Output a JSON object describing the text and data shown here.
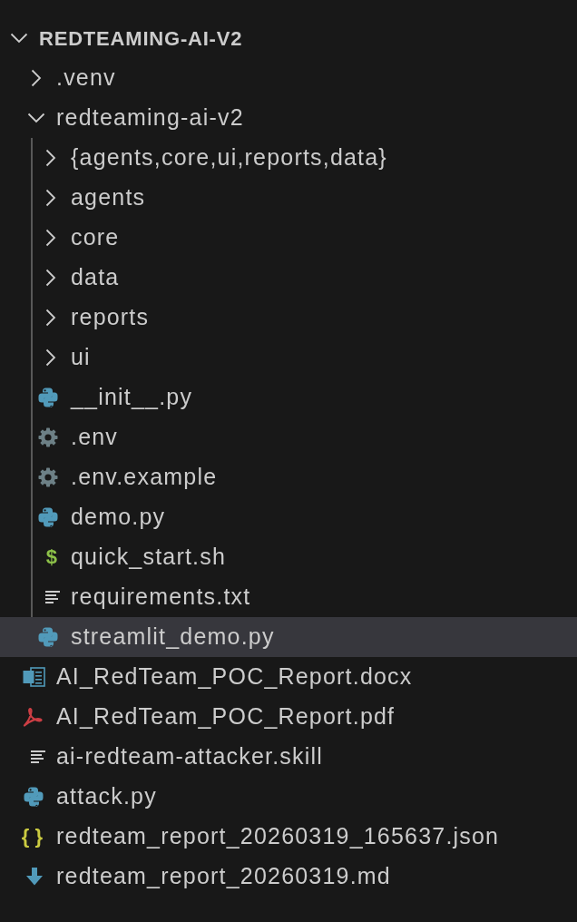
{
  "explorer": {
    "root": {
      "label": "REDTEAMING-AI-V2",
      "expanded": true,
      "children": [
        {
          "label": ".venv",
          "kind": "folder",
          "expanded": false,
          "selected": false
        },
        {
          "label": "redteaming-ai-v2",
          "kind": "folder",
          "expanded": true,
          "selected": false,
          "children": [
            {
              "label": "{agents,core,ui,reports,data}",
              "kind": "folder",
              "expanded": false,
              "selected": false
            },
            {
              "label": "agents",
              "kind": "folder",
              "expanded": false,
              "selected": false
            },
            {
              "label": "core",
              "kind": "folder",
              "expanded": false,
              "selected": false
            },
            {
              "label": "data",
              "kind": "folder",
              "expanded": false,
              "selected": false
            },
            {
              "label": "reports",
              "kind": "folder",
              "expanded": false,
              "selected": false
            },
            {
              "label": "ui",
              "kind": "folder",
              "expanded": false,
              "selected": false
            },
            {
              "label": "__init__.py",
              "kind": "python",
              "selected": false
            },
            {
              "label": ".env",
              "kind": "config",
              "selected": false
            },
            {
              "label": ".env.example",
              "kind": "config",
              "selected": false
            },
            {
              "label": "demo.py",
              "kind": "python",
              "selected": false
            },
            {
              "label": "quick_start.sh",
              "kind": "shell",
              "glyph": "$",
              "selected": false
            },
            {
              "label": "requirements.txt",
              "kind": "text",
              "selected": false
            },
            {
              "label": "streamlit_demo.py",
              "kind": "python",
              "selected": true
            }
          ]
        },
        {
          "label": "AI_RedTeam_POC_Report.docx",
          "kind": "word",
          "selected": false
        },
        {
          "label": "AI_RedTeam_POC_Report.pdf",
          "kind": "pdf",
          "selected": false
        },
        {
          "label": "ai-redteam-attacker.skill",
          "kind": "text",
          "selected": false
        },
        {
          "label": "attack.py",
          "kind": "python",
          "selected": false
        },
        {
          "label": "redteam_report_20260319_165637.json",
          "kind": "json",
          "glyph": "{ }",
          "selected": false
        },
        {
          "label": "redteam_report_20260319.md",
          "kind": "markdown",
          "selected": false
        }
      ]
    }
  }
}
